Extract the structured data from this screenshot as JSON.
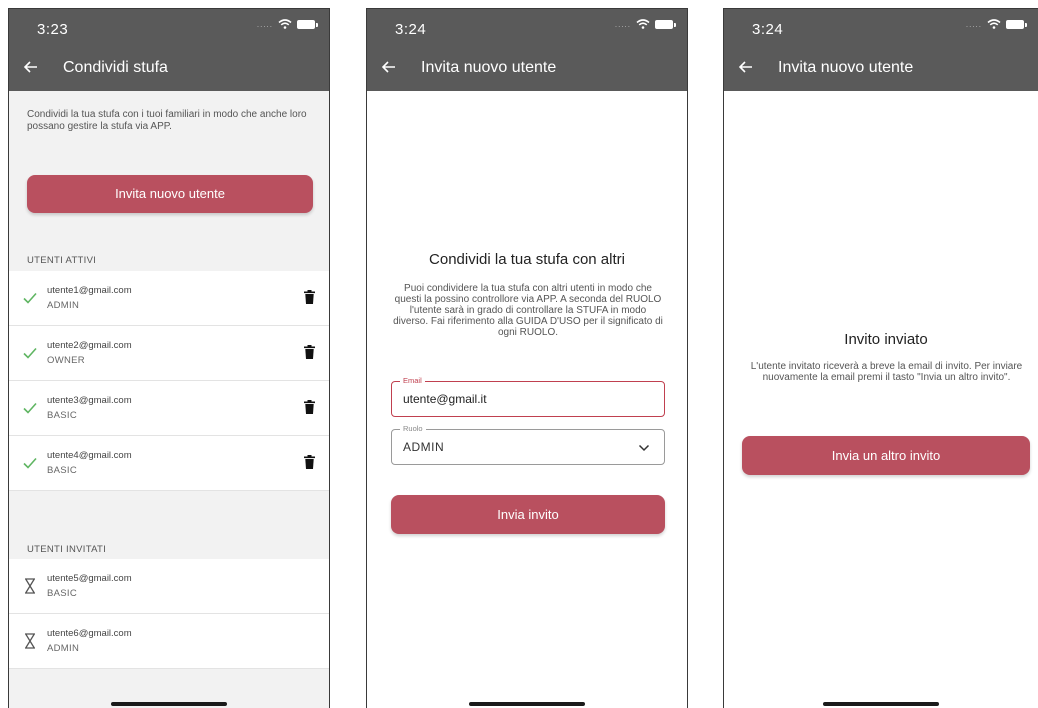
{
  "colors": {
    "accent": "#b9505f",
    "appbar": "#5a5a5a",
    "check": "#5fb562",
    "error_border": "#c0404f"
  },
  "screen1": {
    "time": "3:23",
    "title": "Condividi stufa",
    "intro": "Condividi la tua stufa con i tuoi familiari in modo che anche loro possano gestire la stufa via APP.",
    "invite_button": "Invita nuovo utente",
    "active_label": "UTENTI ATTIVI",
    "active_users": [
      {
        "email": "utente1@gmail.com",
        "role": "ADMIN"
      },
      {
        "email": "utente2@gmail.com",
        "role": "OWNER"
      },
      {
        "email": "utente3@gmail.com",
        "role": "BASIC"
      },
      {
        "email": "utente4@gmail.com",
        "role": "BASIC"
      }
    ],
    "invited_label": "UTENTI INVITATI",
    "invited_users": [
      {
        "email": "utente5@gmail.com",
        "role": "BASIC"
      },
      {
        "email": "utente6@gmail.com",
        "role": "ADMIN"
      }
    ]
  },
  "screen2": {
    "time": "3:24",
    "title": "Invita nuovo utente",
    "heading": "Condividi la tua stufa con altri",
    "description": "Puoi condividere la tua stufa con altri utenti in modo che questi la possino controllore via APP. A seconda del RUOLO l'utente sarà in grado di controllare la STUFA in modo diverso. Fai riferimento alla GUIDA D'USO per il significato di ogni RUOLO.",
    "email_label": "Email",
    "email_value": "utente@gmail.it",
    "role_label": "Ruolo",
    "role_value": "ADMIN",
    "send_button": "Invia invito"
  },
  "screen3": {
    "time": "3:24",
    "title": "Invita nuovo utente",
    "heading": "Invito inviato",
    "description": "L'utente invitato riceverà a breve la email di invito. Per inviare nuovamente la email premi il tasto \"Invia un altro invito\".",
    "resend_button": "Invia un altro invito"
  }
}
